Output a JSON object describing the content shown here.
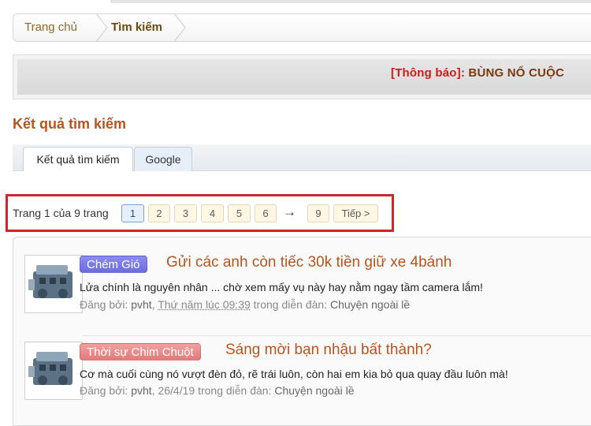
{
  "breadcrumb": {
    "home": "Trang chủ",
    "current": "Tìm kiếm"
  },
  "notice": {
    "tag": "[Thông báo]",
    "text": ": BÙNG NỔ CUỘC"
  },
  "page_title": "Kết quả tìm kiếm",
  "tabs": [
    {
      "label": "Kết quả tìm kiếm"
    },
    {
      "label": "Google"
    }
  ],
  "pagination": {
    "label": "Trang 1 của 9 trang",
    "pages": [
      "1",
      "2",
      "3",
      "4",
      "5",
      "6"
    ],
    "current": "1",
    "arrow": "→",
    "last": "9",
    "next": "Tiếp >"
  },
  "results": [
    {
      "prefix": "Chém Gió",
      "title": "Gửi các anh còn tiếc 30k tiền giữ xe 4bánh",
      "snippet": "Lửa chính là nguyên nhân ... chờ xem mấy vụ này hay nằm ngay tầm camera lắm!",
      "by_label": "Đăng bởi:",
      "author": "pvht",
      "date": "Thứ năm lúc 09:39",
      "in_label": "trong diễn đàn:",
      "forum": "Chuyện ngoài lề"
    },
    {
      "prefix": "Thời sự Chim Chuột",
      "title": "Sáng mời bạn nhậu bất thành?",
      "snippet": "Cơ mà cuối cùng nó vượt đèn đỏ, rẽ trái luôn, còn hai em kia bỏ qua quay đầu luôn mà!",
      "by_label": "Đăng bởi:",
      "author": "pvht",
      "date": "26/4/19",
      "in_label": "trong diễn đàn:",
      "forum": "Chuyện ngoài lề"
    }
  ],
  "icons": {
    "thumbnail": "engine-thumbnail-icon",
    "separator": "chevron-separator-icon"
  },
  "colors": {
    "title": "#b8541c",
    "notice_tag": "#d01a1a",
    "highlight": "#d0252b",
    "prefix_chat": "#7b7be9",
    "prefix_news": "#ea8a8a"
  }
}
